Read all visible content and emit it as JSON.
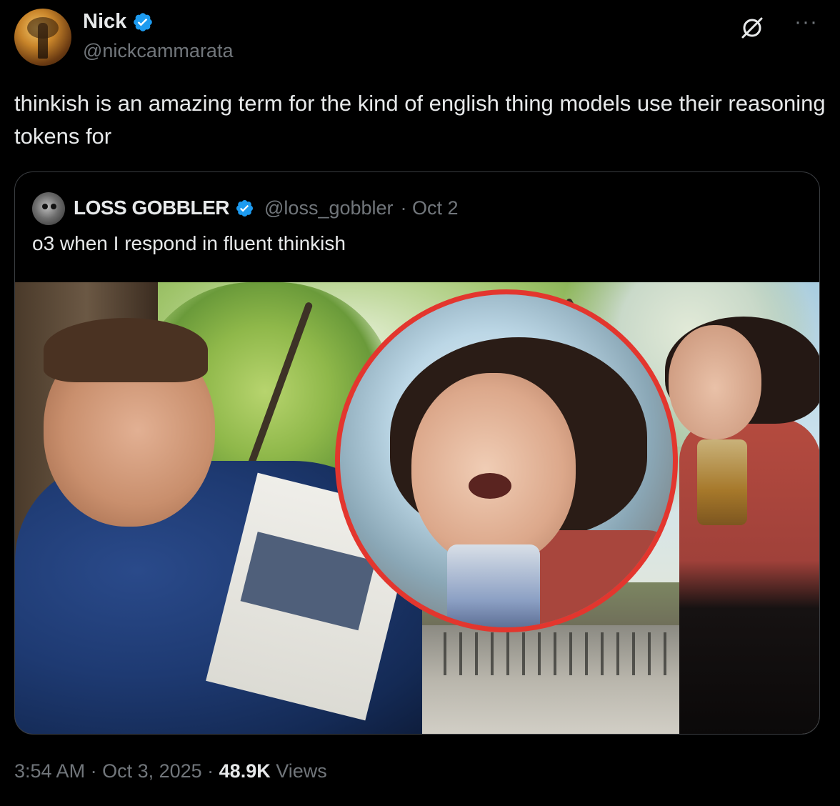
{
  "author": {
    "name": "Nick",
    "handle": "@nickcammarata",
    "verified": true
  },
  "tweet": {
    "text": "thinkish is an amazing term for the kind of english thing models use their reasoning tokens for"
  },
  "quoted_tweet": {
    "name": "LOSS GOBBLER",
    "handle": "@loss_gobbler",
    "date": "· Oct 2",
    "verified": true,
    "text": "o3 when I respond in fluent thinkish"
  },
  "footer": {
    "time": "3:54 AM",
    "sep1": " · ",
    "date": "Oct 3, 2025",
    "sep2": " · ",
    "views_count": "48.9K",
    "views_label": " Views"
  },
  "icons": {
    "grok": "grok-icon",
    "more": "more-icon",
    "verified": "verified-badge-icon"
  },
  "colors": {
    "background": "#000000",
    "text": "#e7e9ea",
    "secondary": "#71767b",
    "verified": "#1d9bf0",
    "highlight_circle": "#e3362e",
    "border": "#3a3d41"
  }
}
